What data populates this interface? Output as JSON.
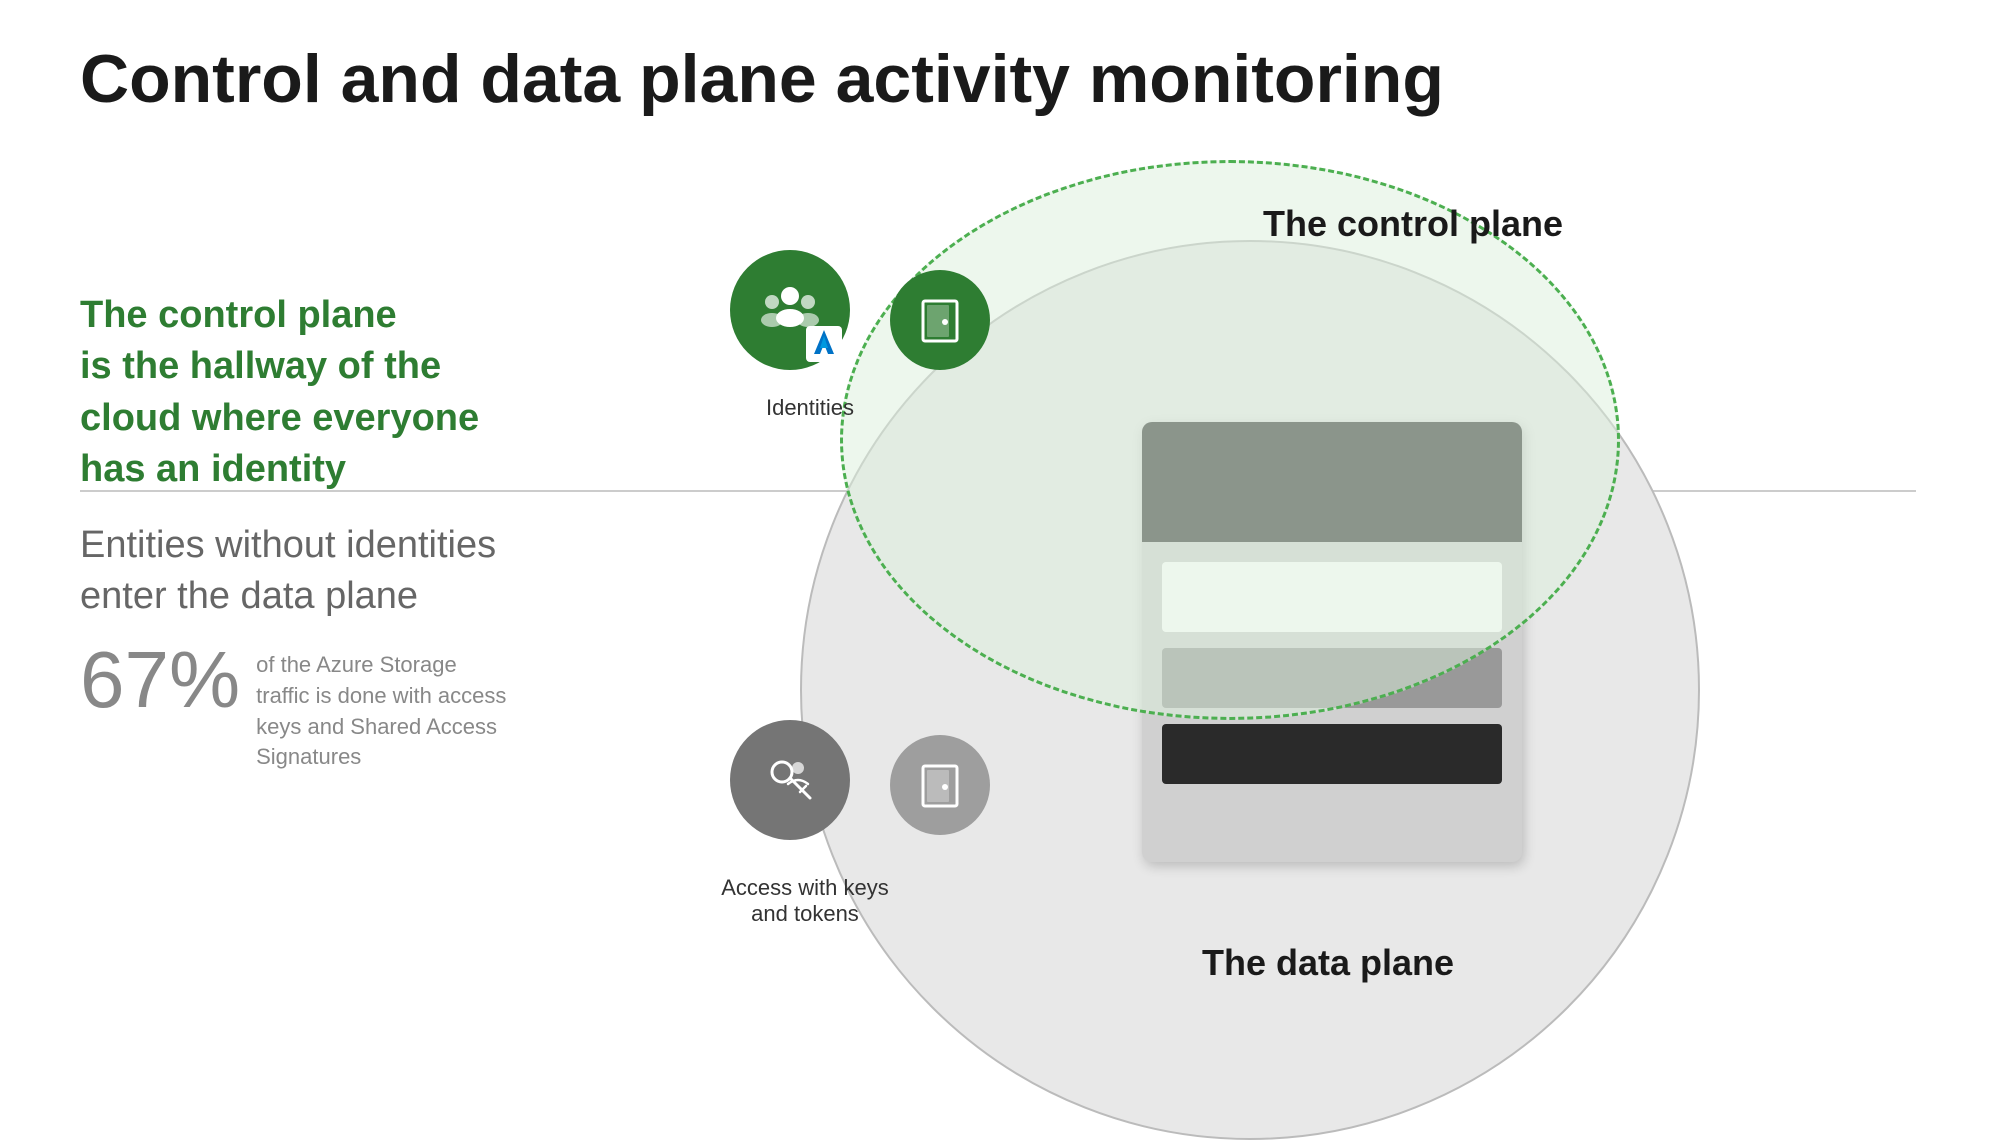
{
  "title": "Control and data plane activity monitoring",
  "control_plane_text": {
    "line1": "The control plane",
    "line2": "is the hallway of the",
    "line3": "cloud where everyone",
    "line4": "has an identity"
  },
  "data_plane_text": {
    "line1": "Entities without identities",
    "line2": "enter the data plane"
  },
  "stat": {
    "percent": "67%",
    "description": "of the Azure Storage traffic is done with access keys and Shared Access Signatures"
  },
  "diagram": {
    "control_plane_label": "The control plane",
    "data_plane_label": "The data plane",
    "identities_label": "Identities",
    "access_label": "Access with keys\nand tokens"
  },
  "colors": {
    "title_color": "#1a1a1a",
    "green_text": "#2e7d32",
    "gray_text": "#666666",
    "stat_color": "#888888",
    "green_dark": "#1b5e20",
    "green_medium": "#2e7d32",
    "gray_medium": "#757575",
    "gray_light": "#9e9e9e"
  }
}
